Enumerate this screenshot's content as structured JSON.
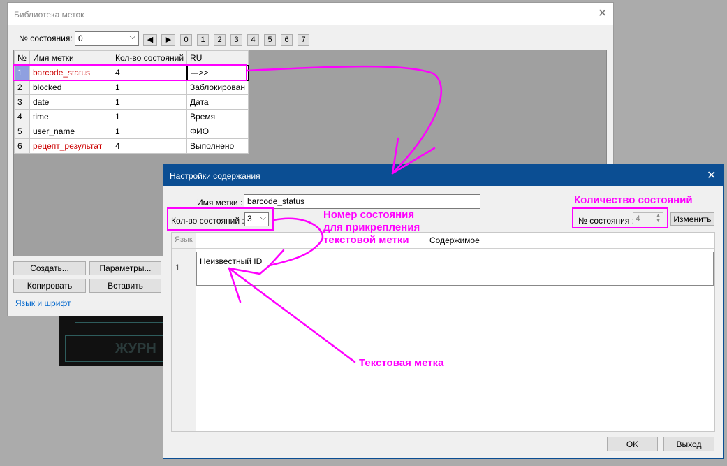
{
  "library_window": {
    "title": "Библиотека меток",
    "state_label": "№ состояния:",
    "state_value": "0",
    "state_buttons": [
      "0",
      "1",
      "2",
      "3",
      "4",
      "5",
      "6",
      "7"
    ],
    "columns": [
      "№",
      "Имя метки",
      "Кол-во состояний",
      "RU"
    ],
    "rows": [
      {
        "num": "1",
        "name": "barcode_status",
        "count": "4",
        "ru": "--->>"
      },
      {
        "num": "2",
        "name": "blocked",
        "count": "1",
        "ru": "Заблокирован"
      },
      {
        "num": "3",
        "name": "date",
        "count": "1",
        "ru": "Дата"
      },
      {
        "num": "4",
        "name": "time",
        "count": "1",
        "ru": "Время"
      },
      {
        "num": "5",
        "name": "user_name",
        "count": "1",
        "ru": "ФИО"
      },
      {
        "num": "6",
        "name": "рецепт_результат",
        "count": "4",
        "ru": "Выполнено"
      }
    ],
    "create_btn": "Создать...",
    "params_btn": "Параметры...",
    "copy_btn": "Копировать",
    "paste_btn": "Вставить",
    "lang_link": "Язык и шрифт"
  },
  "background_text": "ЖУРН",
  "content_dialog": {
    "title": "Настройки содержания",
    "name_label": "Имя метки :",
    "name_value": "barcode_status",
    "count_label": "Кол-во состояний :",
    "count_value": "3",
    "state_label": "№ состояния :",
    "state_value": "4",
    "change_btn": "Изменить",
    "col_lang": "Язык",
    "col_content": "Содержимое",
    "row_num": "1",
    "row_text": "Неизвестный ID",
    "ok_btn": "OK",
    "exit_btn": "Выход"
  },
  "annotations": {
    "count_states": "Количество состояний",
    "state_number": "Номер состояния для прикрепления текстовой метки",
    "text_label": "Текстовая метка"
  },
  "colors": {
    "annotation": "#ff00ff",
    "dialog_title_bar": "#0b4e93",
    "selected_row_header": "#8fa0e0",
    "red_text": "#cc0000"
  }
}
